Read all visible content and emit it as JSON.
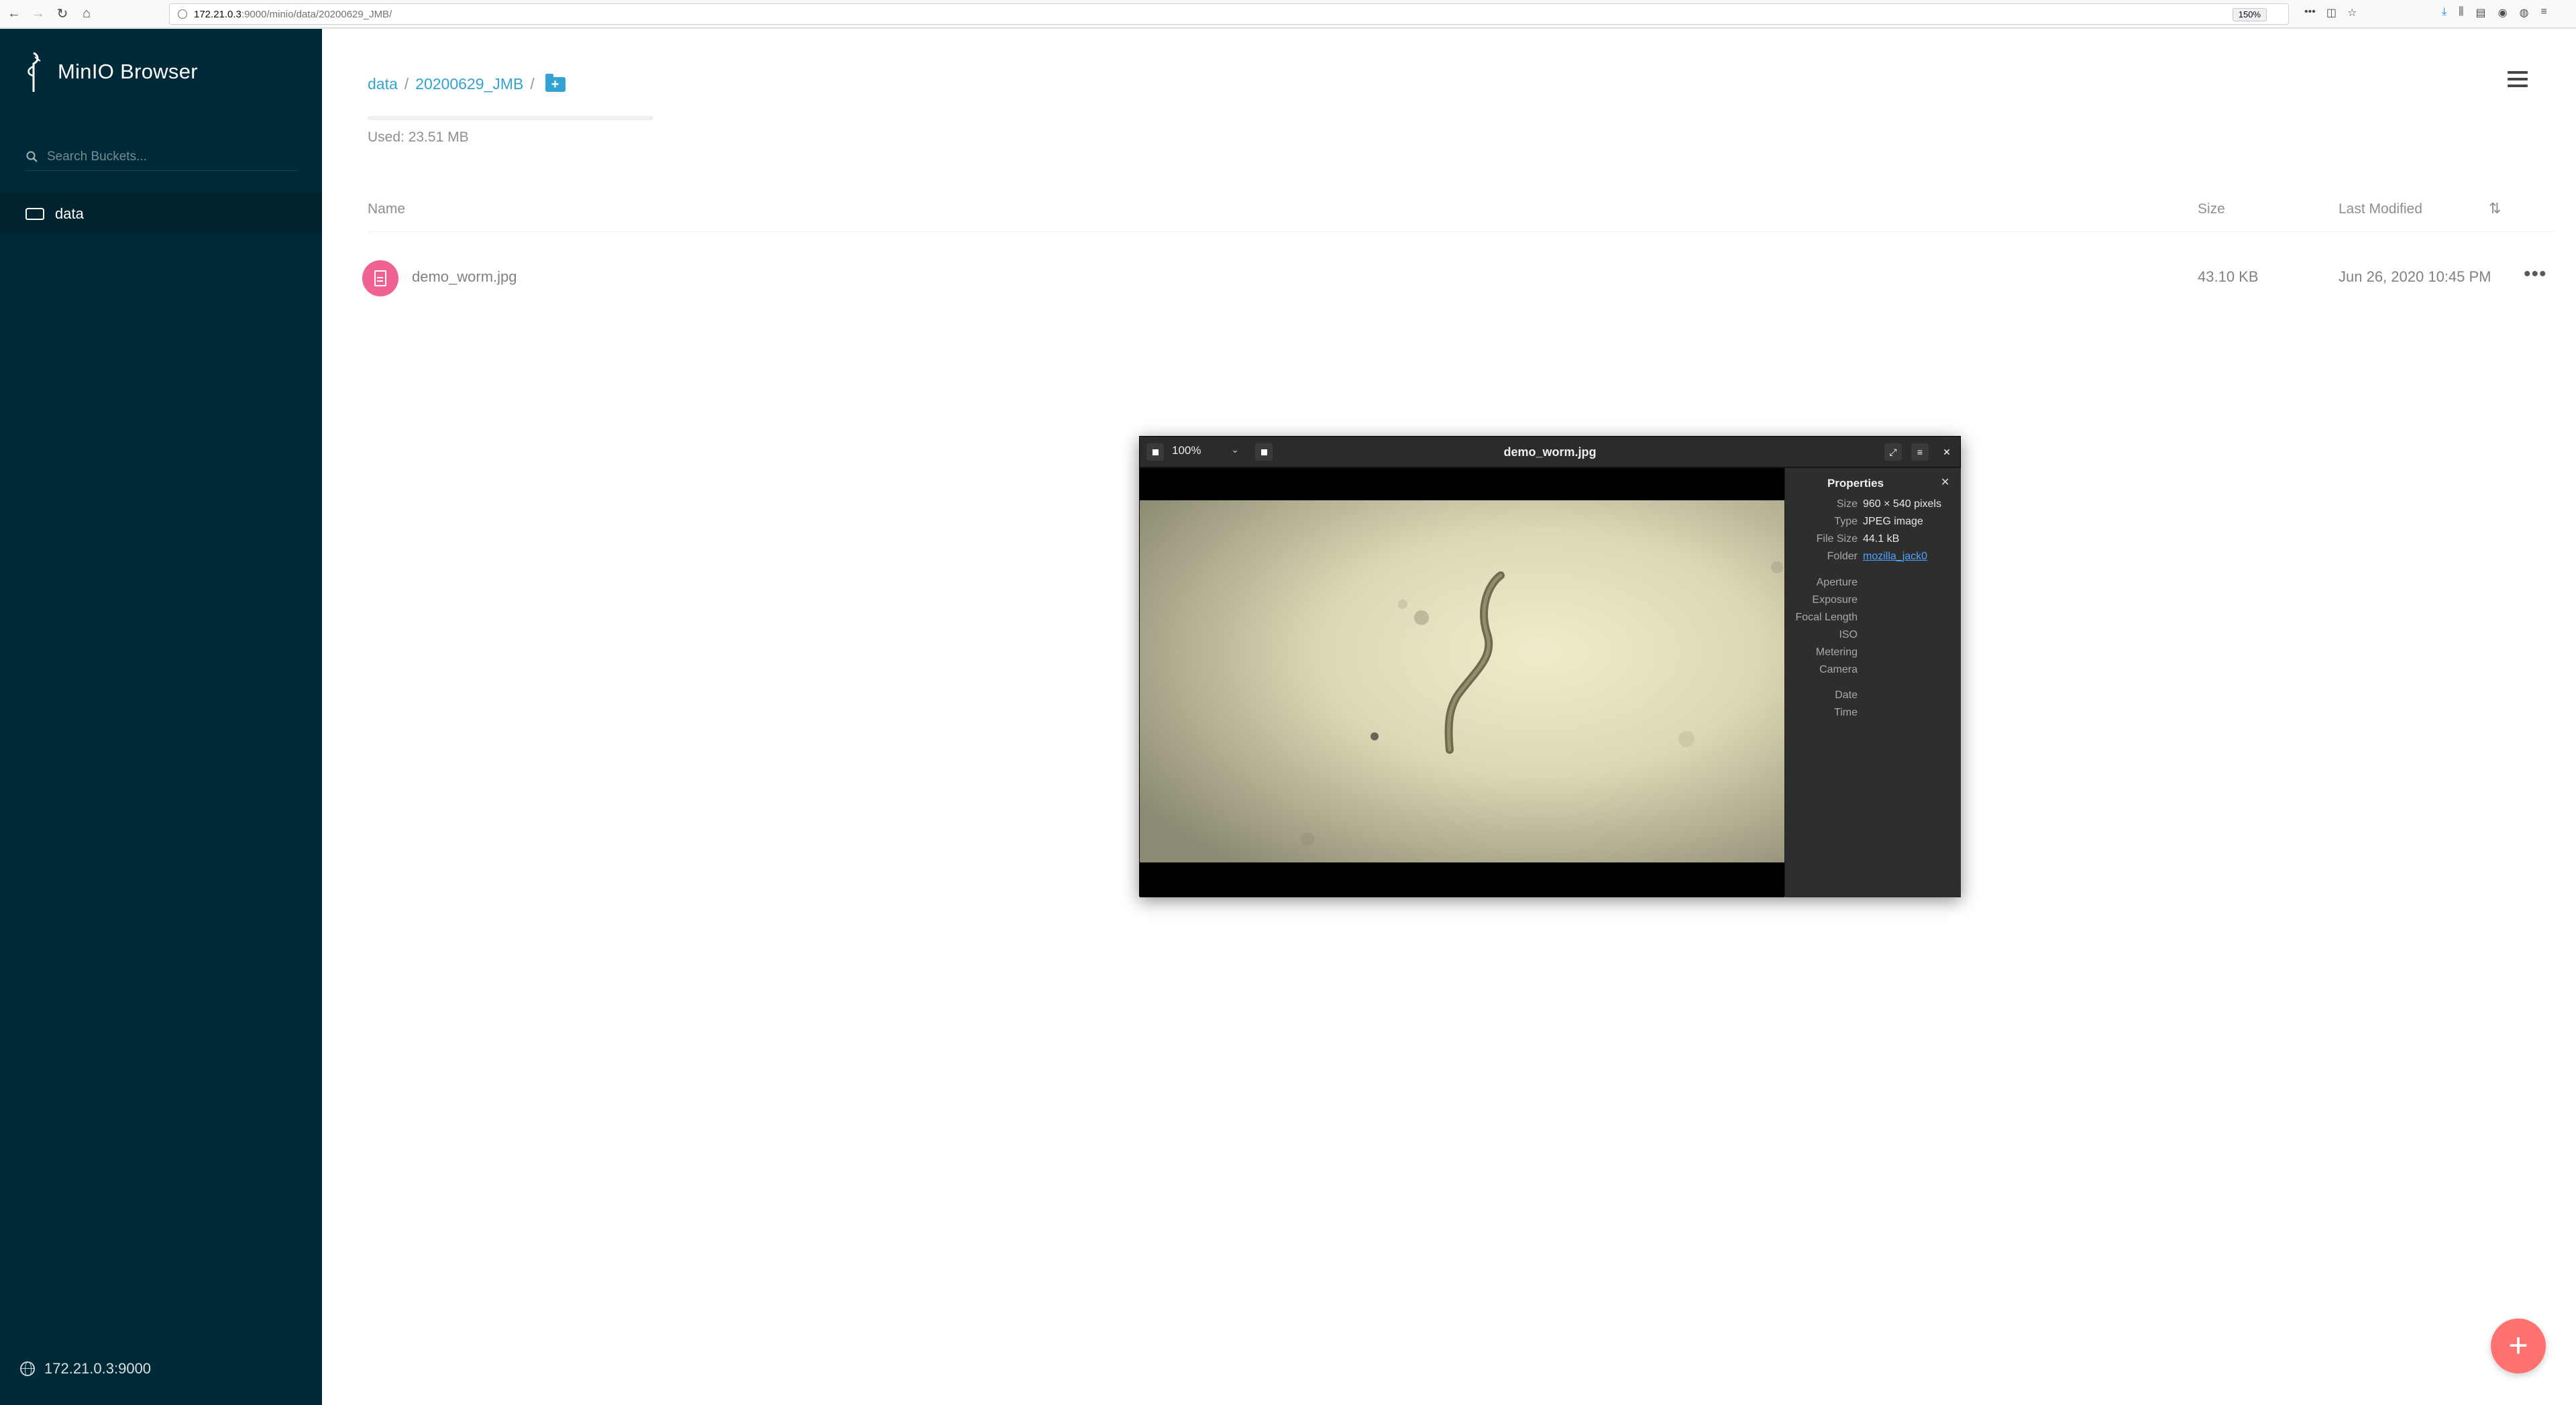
{
  "browser": {
    "url_host": "172.21.0.3",
    "url_path": ":9000/minio/data/20200629_JMB/",
    "zoom": "150%"
  },
  "sidebar": {
    "app_title": "MinIO Browser",
    "search_placeholder": "Search Buckets...",
    "buckets": [
      {
        "label": "data"
      }
    ],
    "host": "172.21.0.3:9000",
    "background": "#002a37"
  },
  "main": {
    "breadcrumb": {
      "bucket": "data",
      "folder": "20200629_JMB",
      "separator": "/"
    },
    "usage": {
      "used_text": "Used: 23.51 MB"
    },
    "columns": {
      "name": "Name",
      "size": "Size",
      "modified": "Last Modified"
    },
    "files": [
      {
        "name": "demo_worm.jpg",
        "size": "43.10 KB",
        "modified": "Jun 26, 2020 10:45 PM"
      }
    ],
    "fab_label": "+"
  },
  "viewer": {
    "title": "demo_worm.jpg",
    "zoom": "100%",
    "properties": {
      "title": "Properties",
      "rows": [
        {
          "key": "Size",
          "value": "960 × 540 pixels"
        },
        {
          "key": "Type",
          "value": "JPEG image"
        },
        {
          "key": "File Size",
          "value": "44.1 kB"
        },
        {
          "key": "Folder",
          "value": "mozilla_jack0"
        },
        {
          "key": "Aperture",
          "value": ""
        },
        {
          "key": "Exposure",
          "value": ""
        },
        {
          "key": "Focal Length",
          "value": ""
        },
        {
          "key": "ISO",
          "value": ""
        },
        {
          "key": "Metering",
          "value": ""
        },
        {
          "key": "Camera",
          "value": ""
        },
        {
          "key": "Date",
          "value": ""
        },
        {
          "key": "Time",
          "value": ""
        }
      ]
    }
  },
  "colors": {
    "accent": "#32a3d4",
    "file_icon": "#f06292",
    "fab": "#ff726f"
  }
}
